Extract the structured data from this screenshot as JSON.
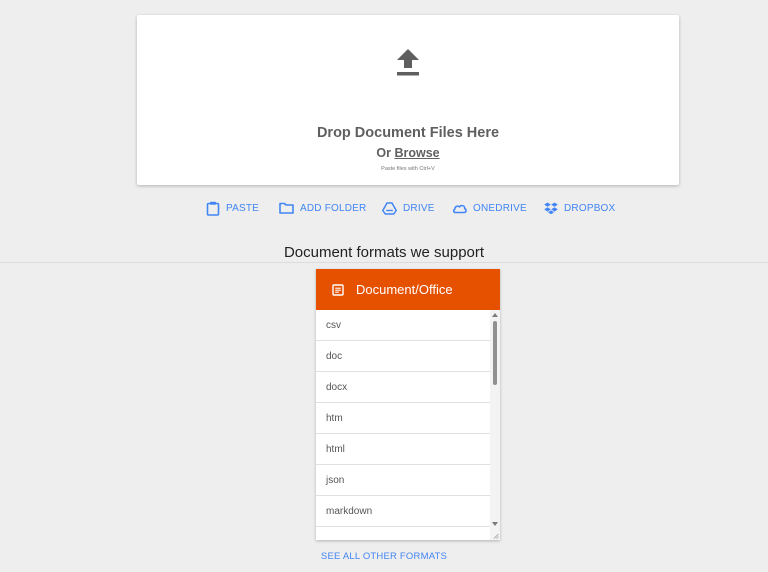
{
  "dropzone": {
    "title": "Drop Document Files Here",
    "or_text": "Or",
    "browse_label": "Browse",
    "paste_hint": "Paste files with Ctrl+V"
  },
  "sources": [
    {
      "label": "PASTE",
      "icon": "clipboard-icon"
    },
    {
      "label": "ADD FOLDER",
      "icon": "folder-icon"
    },
    {
      "label": "DRIVE",
      "icon": "google-drive-icon"
    },
    {
      "label": "ONEDRIVE",
      "icon": "onedrive-icon"
    },
    {
      "label": "DROPBOX",
      "icon": "dropbox-icon"
    }
  ],
  "formats": {
    "heading": "Document formats we support",
    "category": "Document/Office",
    "category_icon": "document-icon",
    "items": [
      "csv",
      "doc",
      "docx",
      "htm",
      "html",
      "json",
      "markdown"
    ],
    "see_all": "SEE ALL OTHER FORMATS"
  },
  "colors": {
    "accent": "#4285f4",
    "category_header": "#e65100",
    "background": "#eeeeee"
  }
}
